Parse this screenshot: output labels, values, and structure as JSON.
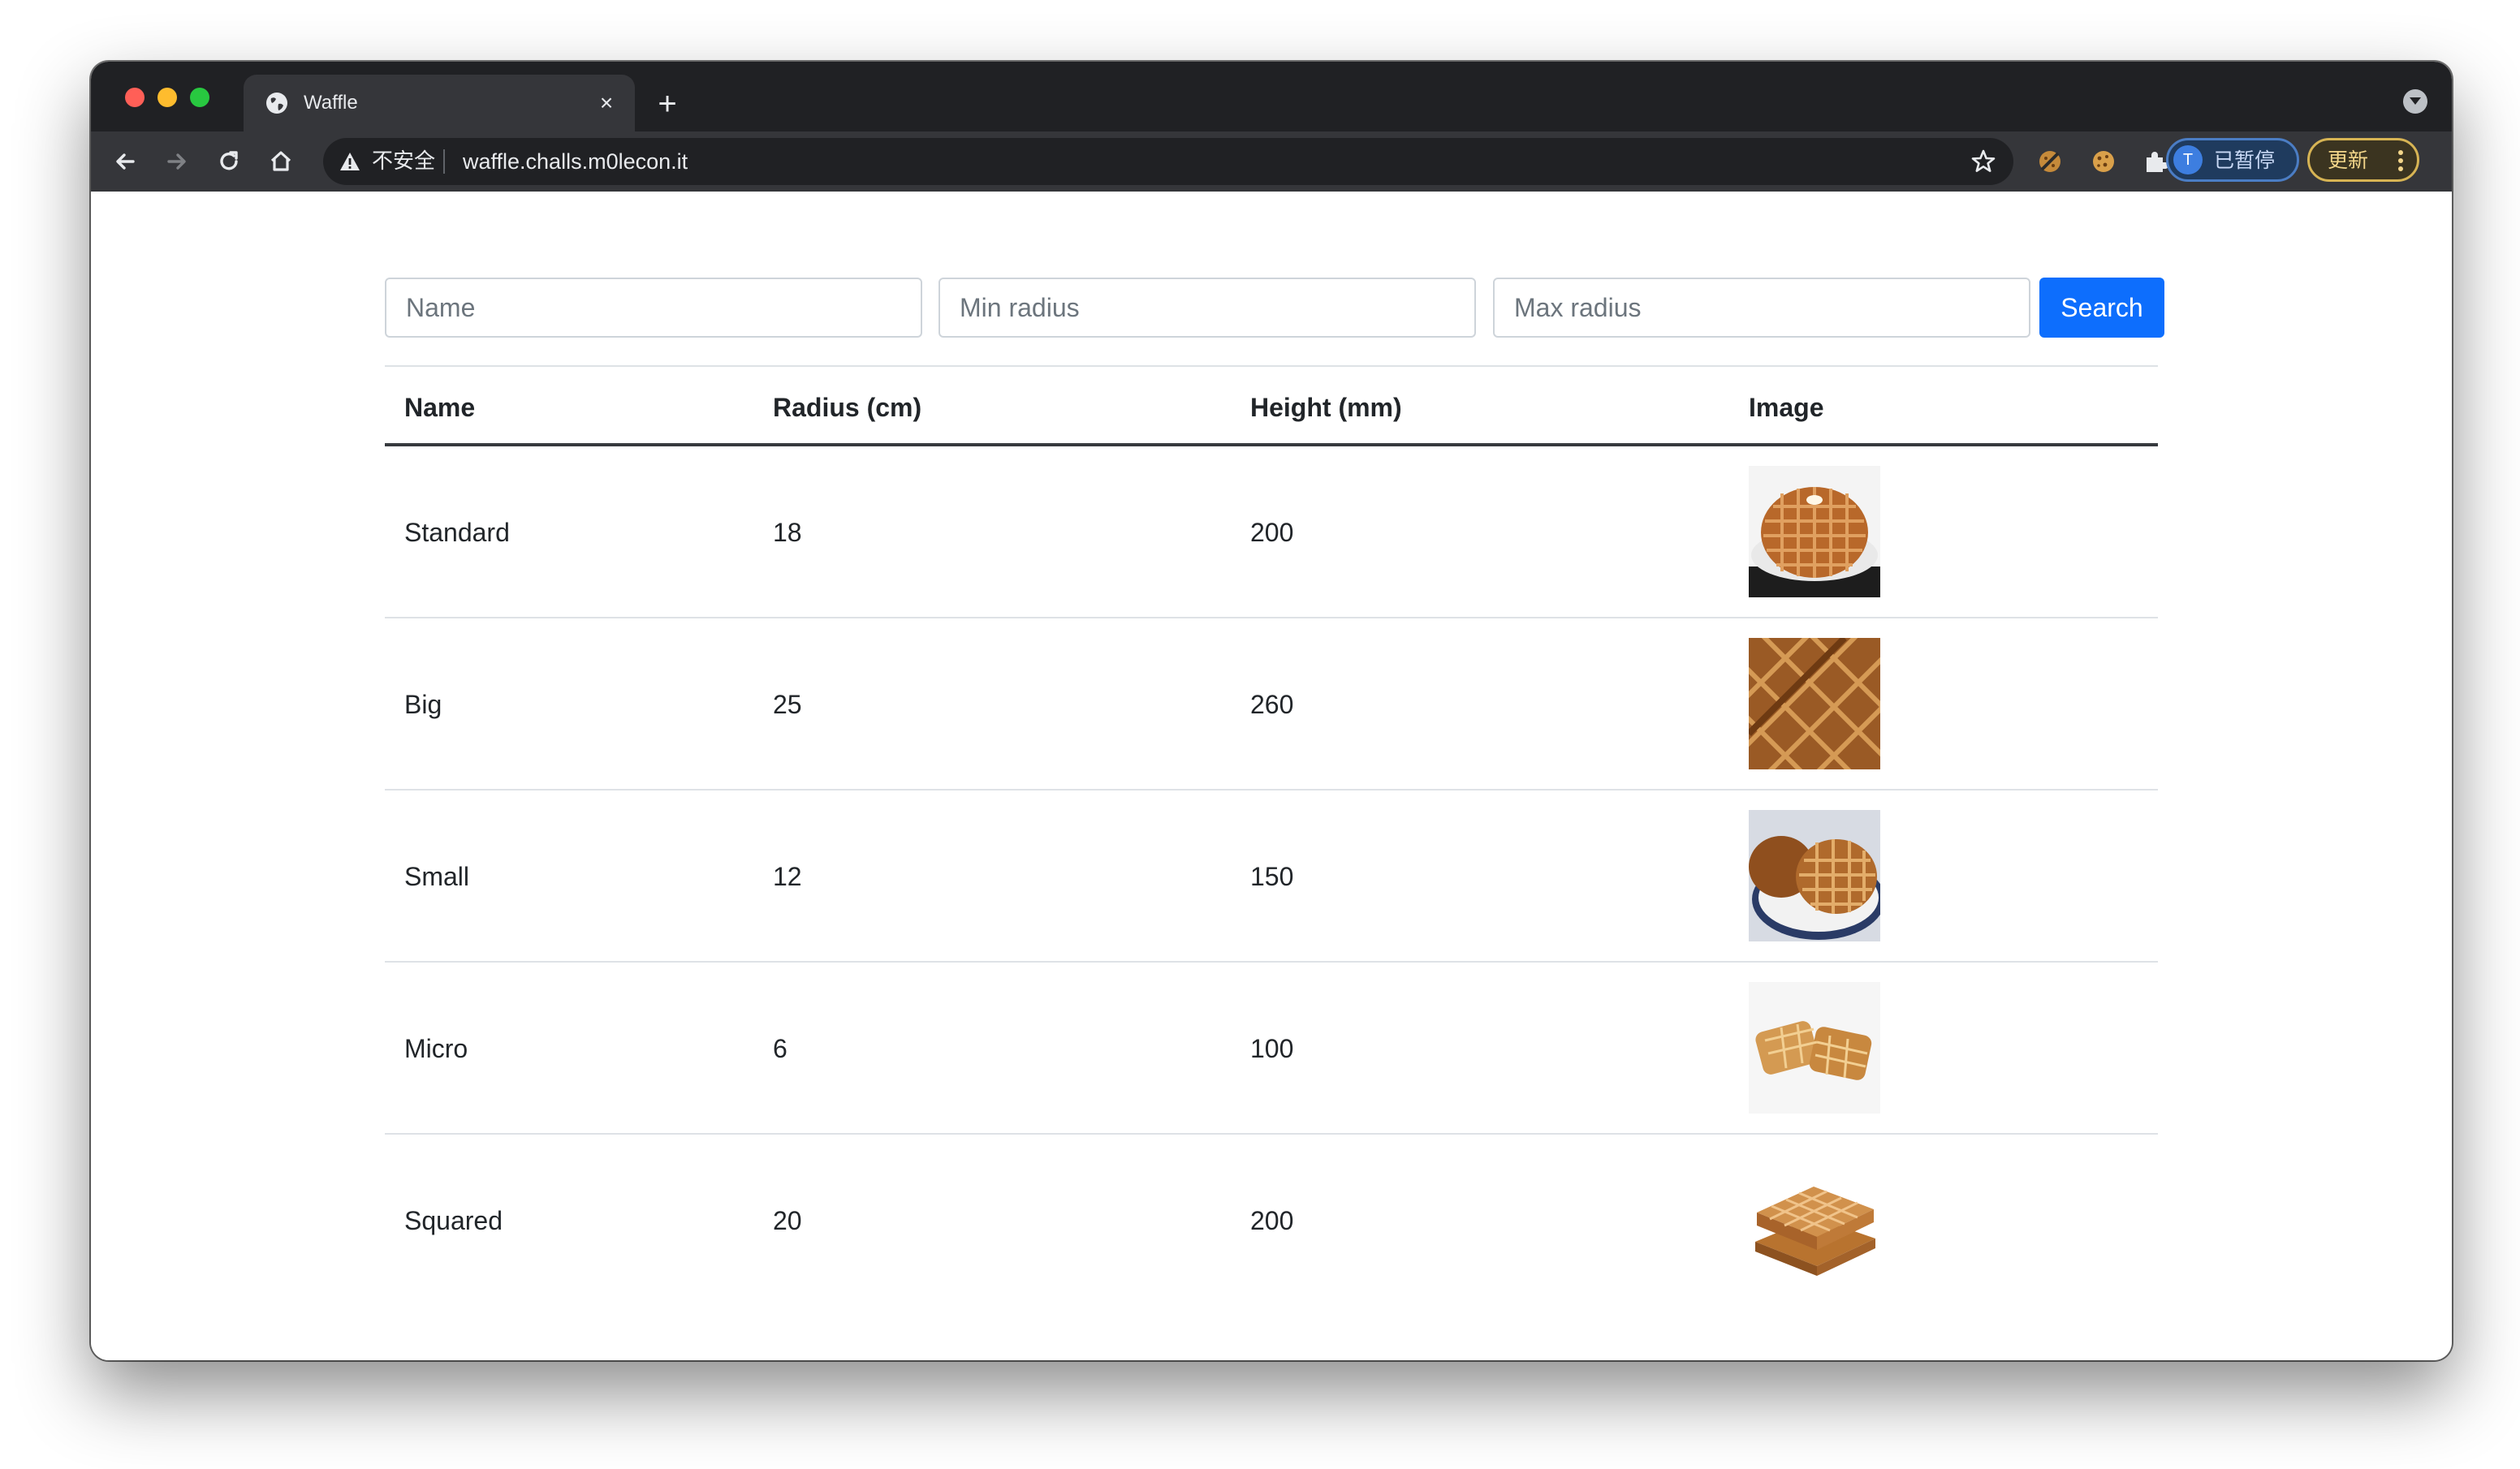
{
  "browser": {
    "tab_title": "Waffle",
    "insecure_label": "不安全",
    "url": "waffle.challs.m0lecon.it",
    "profile_initial": "T",
    "profile_label": "已暂停",
    "update_label": "更新"
  },
  "search": {
    "name_placeholder": "Name",
    "min_radius_placeholder": "Min radius",
    "max_radius_placeholder": "Max radius",
    "button_label": "Search"
  },
  "table": {
    "headers": [
      "Name",
      "Radius (cm)",
      "Height (mm)",
      "Image"
    ],
    "rows": [
      {
        "name": "Standard",
        "radius": "18",
        "height": "200",
        "image": "round-waffle-on-plate"
      },
      {
        "name": "Big",
        "radius": "25",
        "height": "260",
        "image": "large-waffle-closeup"
      },
      {
        "name": "Small",
        "radius": "12",
        "height": "150",
        "image": "small-waffles-on-plate"
      },
      {
        "name": "Micro",
        "radius": "6",
        "height": "100",
        "image": "mini-waffles"
      },
      {
        "name": "Squared",
        "radius": "20",
        "height": "200",
        "image": "stacked-square-waffles"
      }
    ]
  },
  "colors": {
    "accent": "#0d6efd",
    "waffle": "#c07a36"
  }
}
